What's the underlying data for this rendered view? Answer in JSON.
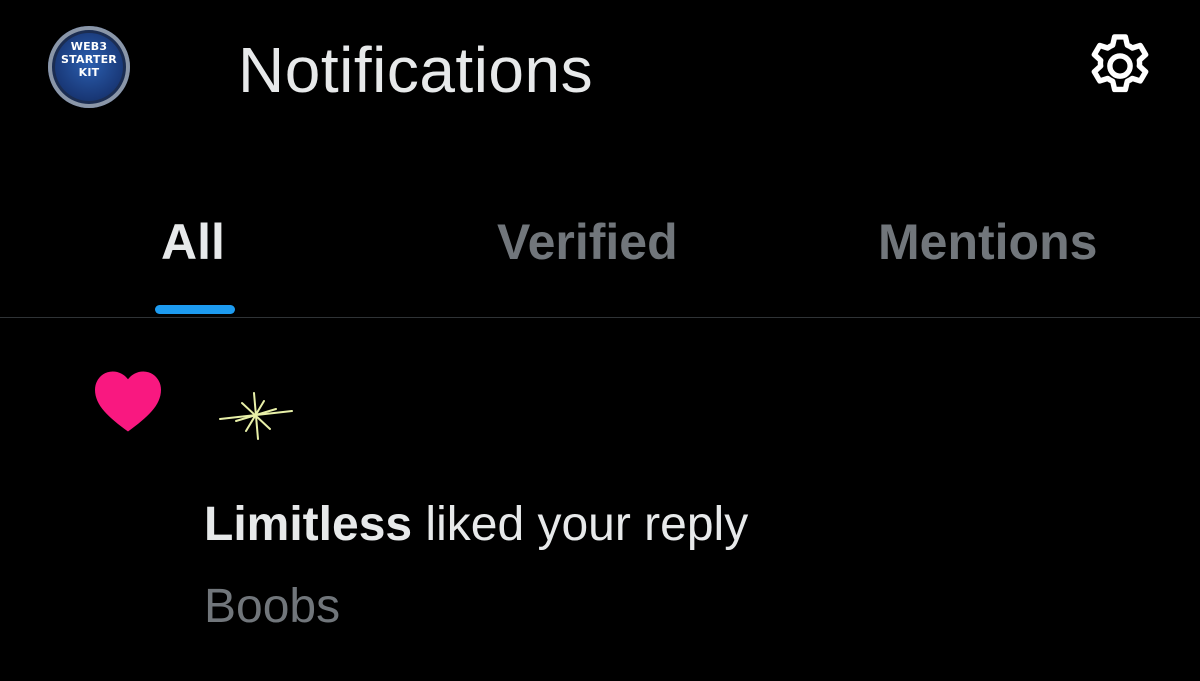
{
  "header": {
    "avatar_text": [
      "WEB3",
      "STARTER",
      "KIT"
    ],
    "title": "Notifications",
    "settings_icon": "gear-icon"
  },
  "tabs": [
    {
      "label": "All",
      "active": true
    },
    {
      "label": "Verified",
      "active": false
    },
    {
      "label": "Mentions",
      "active": false
    }
  ],
  "colors": {
    "background": "#000000",
    "text_primary": "#e7e9ea",
    "text_secondary": "#71767b",
    "accent": "#1d9bf0",
    "like": "#f91880",
    "divider": "#2f3336"
  },
  "notification": {
    "type_icon": "heart-icon",
    "actor": "Limitless",
    "action": " liked your reply",
    "reply_text": "Boobs"
  }
}
